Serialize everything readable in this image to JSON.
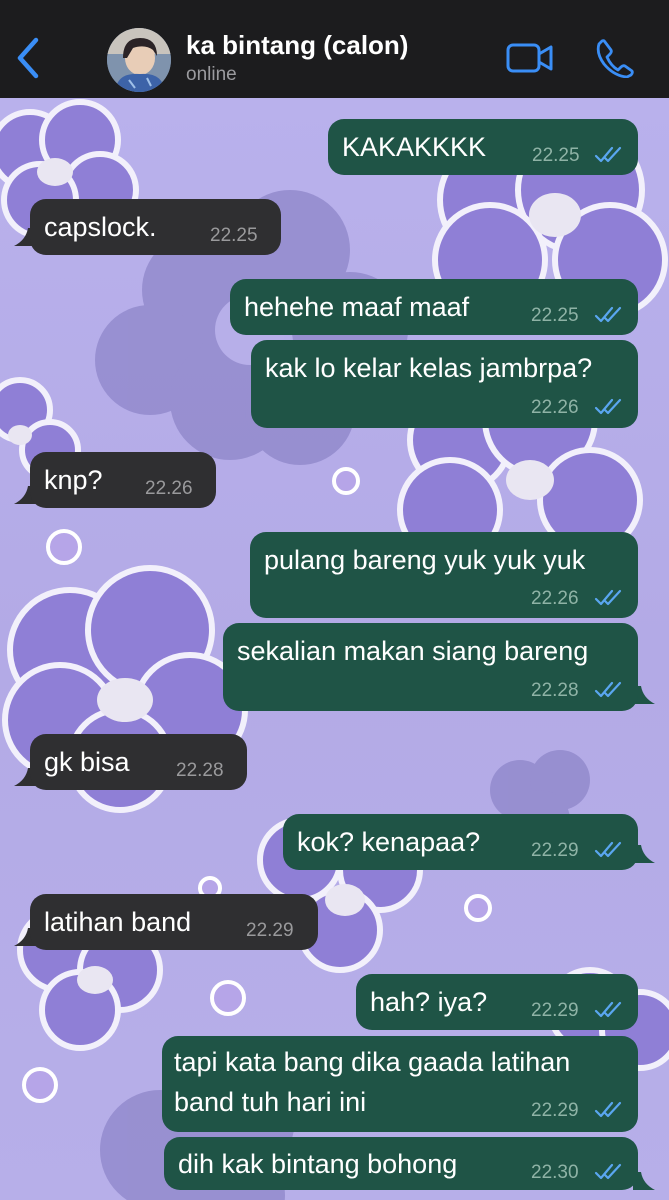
{
  "header": {
    "contact_name": "ka bintang (calon)",
    "status": "online"
  },
  "messages": [
    {
      "text": "KAKAKKKK",
      "time": "22.25",
      "dir": "out"
    },
    {
      "text": "capslock.",
      "time": "22.25",
      "dir": "in"
    },
    {
      "text": "hehehe maaf maaf",
      "time": "22.25",
      "dir": "out"
    },
    {
      "text": "kak lo kelar kelas jambrpa?",
      "time": "22.26",
      "dir": "out"
    },
    {
      "text": "knp?",
      "time": "22.26",
      "dir": "in"
    },
    {
      "text": "pulang bareng yuk yuk yuk",
      "time": "22.26",
      "dir": "out"
    },
    {
      "text": "sekalian makan siang bareng",
      "time": "22.28",
      "dir": "out"
    },
    {
      "text": "gk bisa",
      "time": "22.28",
      "dir": "in"
    },
    {
      "text": "kok? kenapaa?",
      "time": "22.29",
      "dir": "out"
    },
    {
      "text": "latihan band",
      "time": "22.29",
      "dir": "in"
    },
    {
      "text": "hah? iya?",
      "time": "22.29",
      "dir": "out"
    },
    {
      "text_line1": "tapi kata bang dika gaada latihan",
      "text_line2": "band tuh hari ini",
      "time": "22.29",
      "dir": "out"
    },
    {
      "text": "dih kak bintang bohong",
      "time": "22.30",
      "dir": "out"
    }
  ],
  "colors": {
    "outgoing_bubble": "#1f5446",
    "incoming_bubble": "#2f2f31",
    "header_bg": "#1c1c1e",
    "accent": "#3a8ef6",
    "read_ticks": "#5aa6f0",
    "wallpaper": "#b7aee8"
  },
  "icons": [
    "back-chevron-icon",
    "video-call-icon",
    "phone-call-icon",
    "read-ticks-icon"
  ]
}
